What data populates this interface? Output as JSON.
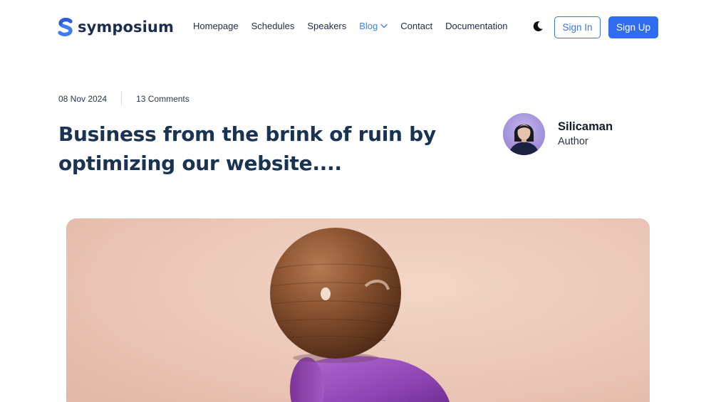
{
  "brand": {
    "name": "symposium",
    "logo_icon": "symposium-s-logo",
    "accent": "#2f6cf0"
  },
  "nav": {
    "items": [
      {
        "label": "Homepage"
      },
      {
        "label": "Schedules"
      },
      {
        "label": "Speakers"
      },
      {
        "label": "Blog",
        "active": true,
        "has_dropdown": true
      },
      {
        "label": "Contact"
      },
      {
        "label": "Documentation"
      }
    ]
  },
  "header": {
    "theme_icon": "moon-icon",
    "sign_in_label": "Sign In",
    "sign_up_label": "Sign Up"
  },
  "article": {
    "date": "08 Nov 2024",
    "comments": "13 Comments",
    "title": "Business from the brink of ruin by optimizing our website....",
    "author": {
      "name": "Silicaman",
      "role": "Author"
    }
  }
}
